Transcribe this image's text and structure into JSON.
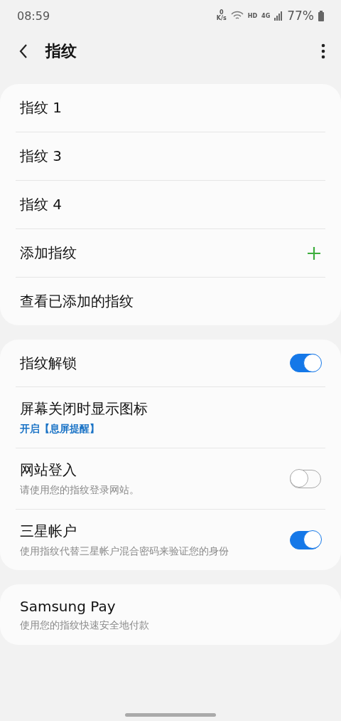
{
  "status_bar": {
    "time": "08:59",
    "net_speed_value": "0",
    "net_speed_unit": "K/s",
    "hd": "HD",
    "network": "4G",
    "battery": "77%"
  },
  "header": {
    "title": "指纹"
  },
  "fingerprints": [
    {
      "kind": "item",
      "label": "指纹 1"
    },
    {
      "kind": "item",
      "label": "指纹 3"
    },
    {
      "kind": "item",
      "label": "指纹 4"
    },
    {
      "kind": "add",
      "label": "添加指纹"
    },
    {
      "kind": "item",
      "label": "查看已添加的指纹"
    }
  ],
  "settings": [
    {
      "kind": "toggle",
      "title": "指纹解锁",
      "on": true
    },
    {
      "kind": "info",
      "title": "屏幕关闭时显示图标",
      "summary": "开启【息屏提醒】",
      "accent": true
    },
    {
      "kind": "toggle",
      "title": "网站登入",
      "summary": "请使用您的指纹登录网站。",
      "accent": false,
      "on": false
    },
    {
      "kind": "toggle",
      "title": "三星帐户",
      "summary": "使用指纹代替三星帐户混合密码来验证您的身份",
      "accent": false,
      "on": true
    }
  ],
  "payments": [
    {
      "title": "Samsung Pay",
      "summary": "使用您的指纹快速安全地付款",
      "accent": false
    }
  ]
}
